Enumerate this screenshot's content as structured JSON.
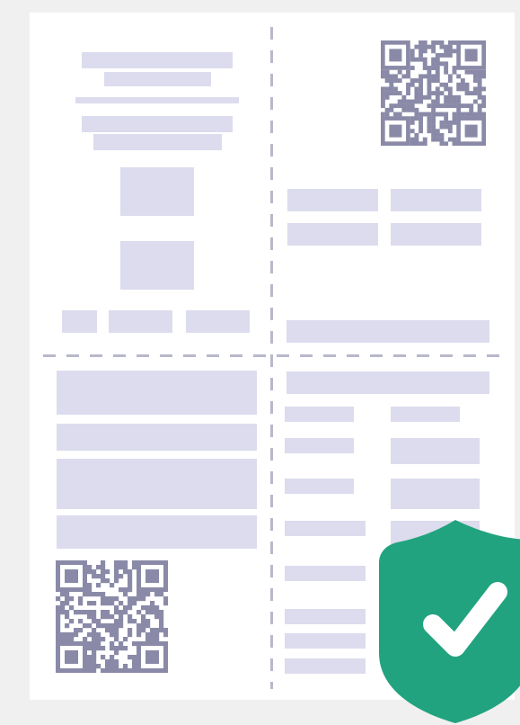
{
  "colors": {
    "page_background": "#f0f0f0",
    "sheet": "#ffffff",
    "placeholder": "#dcdcee",
    "divider": "#b8b8cc",
    "qr_ink": "#8a8aa8",
    "badge": "#22a37f",
    "check": "#ffffff"
  },
  "icons": {
    "top_qr": "qr-code-icon",
    "bottom_qr": "qr-code-icon",
    "badge": "shield-check-icon"
  }
}
